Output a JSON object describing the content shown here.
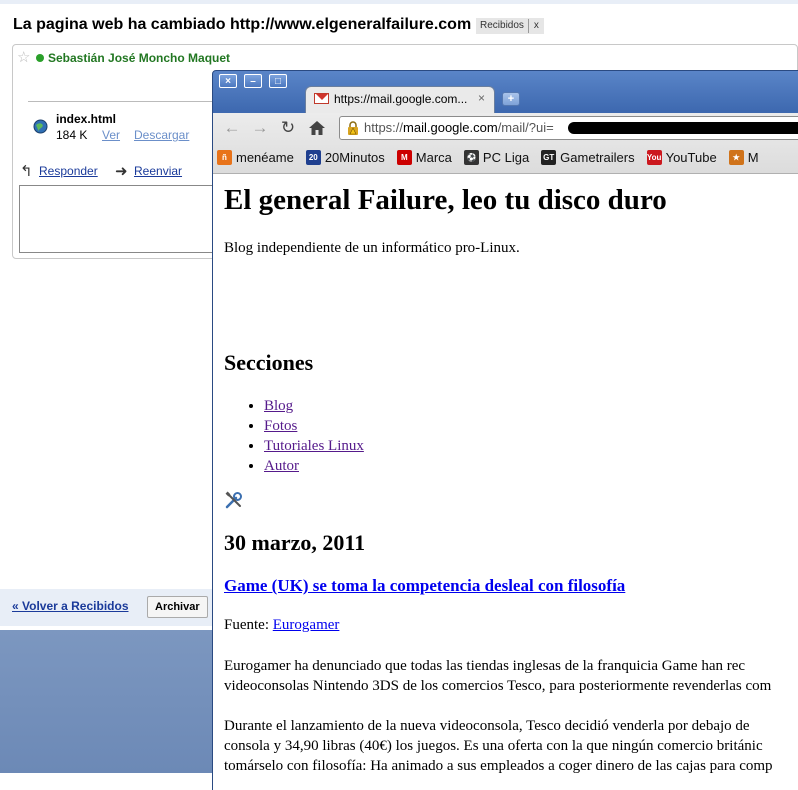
{
  "gmail": {
    "subject": "La pagina web ha cambiado http://www.elgeneralfailure.com",
    "label": "Recibidos",
    "label_remove": "x",
    "sender": "Sebastián José Moncho Maquet",
    "attachment": {
      "filename": "index.html",
      "size": "184 K",
      "view_label": "Ver",
      "download_label": "Descargar"
    },
    "reply_label": "Responder",
    "forward_label": "Reenviar",
    "back_label": "« Volver a Recibidos",
    "archive_label": "Archivar"
  },
  "chrome": {
    "window_buttons": {
      "close": "×",
      "minimize": "–",
      "maximize": "□"
    },
    "tab_title": "https://mail.google.com...",
    "tab_close": "×",
    "new_tab": "+",
    "url_scheme": "https://",
    "url_domain": "mail.google.com",
    "url_path": "/mail/?ui=",
    "bookmarks": [
      {
        "label": "menéame",
        "icon": "meneame-icon",
        "color": "#e8731a"
      },
      {
        "label": "20Minutos",
        "icon": "20minutos-icon",
        "color": "#1f3f8f"
      },
      {
        "label": "Marca",
        "icon": "marca-icon",
        "color": "#cc0000"
      },
      {
        "label": "PC Liga",
        "icon": "soccer-ball-icon",
        "color": "#333333"
      },
      {
        "label": "Gametrailers",
        "icon": "gametrailers-icon",
        "color": "#222222"
      },
      {
        "label": "YouTube",
        "icon": "youtube-icon",
        "color": "#cc181e"
      },
      {
        "label": "M",
        "icon": "bookmark-icon",
        "color": "#d0731a"
      }
    ]
  },
  "page": {
    "title": "El general Failure, leo tu disco duro",
    "tagline": "Blog independiente de un informático pro-Linux.",
    "sections_heading": "Secciones",
    "sections": [
      "Blog",
      "Fotos",
      "Tutoriales Linux",
      "Autor"
    ],
    "date": "30 marzo, 2011",
    "post_title": "Game (UK) se toma la competencia desleal con filosofía",
    "source_label": "Fuente: ",
    "source_link": "Eurogamer",
    "para1": [
      "Eurogamer ha denunciado que todas las tiendas inglesas de la franquicia Game han rec",
      "videoconsolas Nintendo 3DS de los comercios Tesco, para posteriormente revenderlas com"
    ],
    "para2": [
      "Durante el lanzamiento de la nueva videoconsola, Tesco decidió venderla por debajo de",
      "consola y 34,90 libras (40€) los juegos. Es una oferta con la que ningún comercio británic",
      "tomárselo con filosofía: Ha animado a sus empleados a coger dinero de las cajas para comp"
    ]
  }
}
